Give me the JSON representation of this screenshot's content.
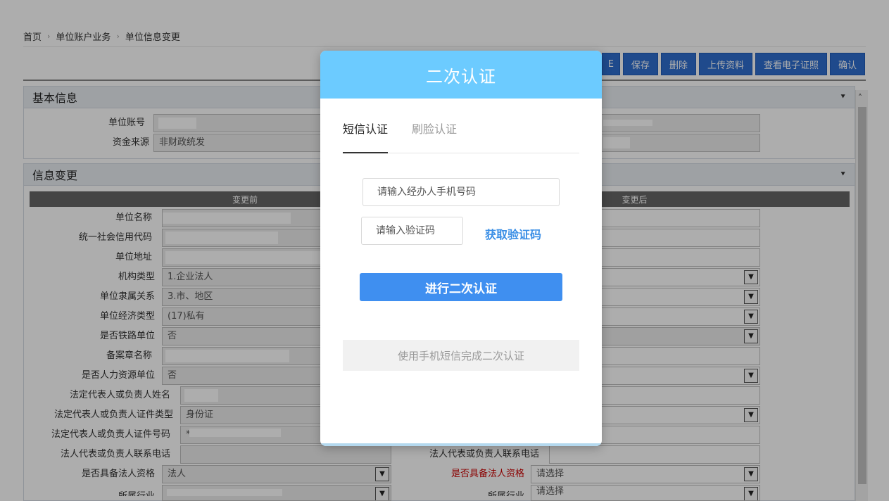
{
  "breadcrumb": {
    "items": [
      "首页",
      "单位账户业务",
      "单位信息变更"
    ],
    "separator": "›"
  },
  "toolbar": {
    "partial_label": "E",
    "buttons": [
      "保存",
      "删除",
      "上传资料",
      "查看电子证照",
      "确认"
    ]
  },
  "basic_info": {
    "title": "基本信息",
    "account_label": "单位账号",
    "fund_source_label": "资金来源",
    "fund_source_value": "非财政统发"
  },
  "change_info": {
    "title": "信息变更",
    "before_header": "变更前",
    "after_header": "变更后",
    "rows": [
      {
        "label": "单位名称",
        "before": ""
      },
      {
        "label": "统一社会信用代码",
        "before": ""
      },
      {
        "label": "单位地址",
        "before": ""
      },
      {
        "label": "机构类型",
        "before": "1.企业法人"
      },
      {
        "label": "单位隶属关系",
        "before": "3.市、地区"
      },
      {
        "label": "单位经济类型",
        "before": "(17)私有"
      },
      {
        "label": "是否铁路单位",
        "before": "否"
      },
      {
        "label": "备案章名称",
        "before": ""
      },
      {
        "label": "是否人力资源单位",
        "before": "否"
      },
      {
        "label": "法定代表人或负责人姓名",
        "before": ""
      },
      {
        "label": "法定代表人或负责人证件类型",
        "before": "身份证"
      },
      {
        "label": "法定代表人或负责人证件号码",
        "before": "*"
      },
      {
        "label": "法人代表或负责人联系电话",
        "before": ""
      },
      {
        "label": "是否具备法人资格",
        "before": "法人"
      },
      {
        "label": "所属行业",
        "before": ""
      }
    ],
    "right_phone_label": "法人代表或负责人联系电话",
    "right_legal_label": "是否具备法人资格",
    "right_legal_value": "请选择",
    "right_industry_label": "所属行业",
    "right_industry_value": "请选择"
  },
  "modal": {
    "title": "二次认证",
    "tabs": [
      "短信认证",
      "刷脸认证"
    ],
    "phone_placeholder": "请输入经办人手机号码",
    "code_placeholder": "请输入验证码",
    "get_code_label": "获取验证码",
    "submit_label": "进行二次认证",
    "tip": "使用手机短信完成二次认证"
  },
  "colors": {
    "modal_header": "#6ccbff",
    "primary_button": "#3f8ff0",
    "toolbar_button": "#2f6ecf",
    "link": "#3b8fe6"
  }
}
